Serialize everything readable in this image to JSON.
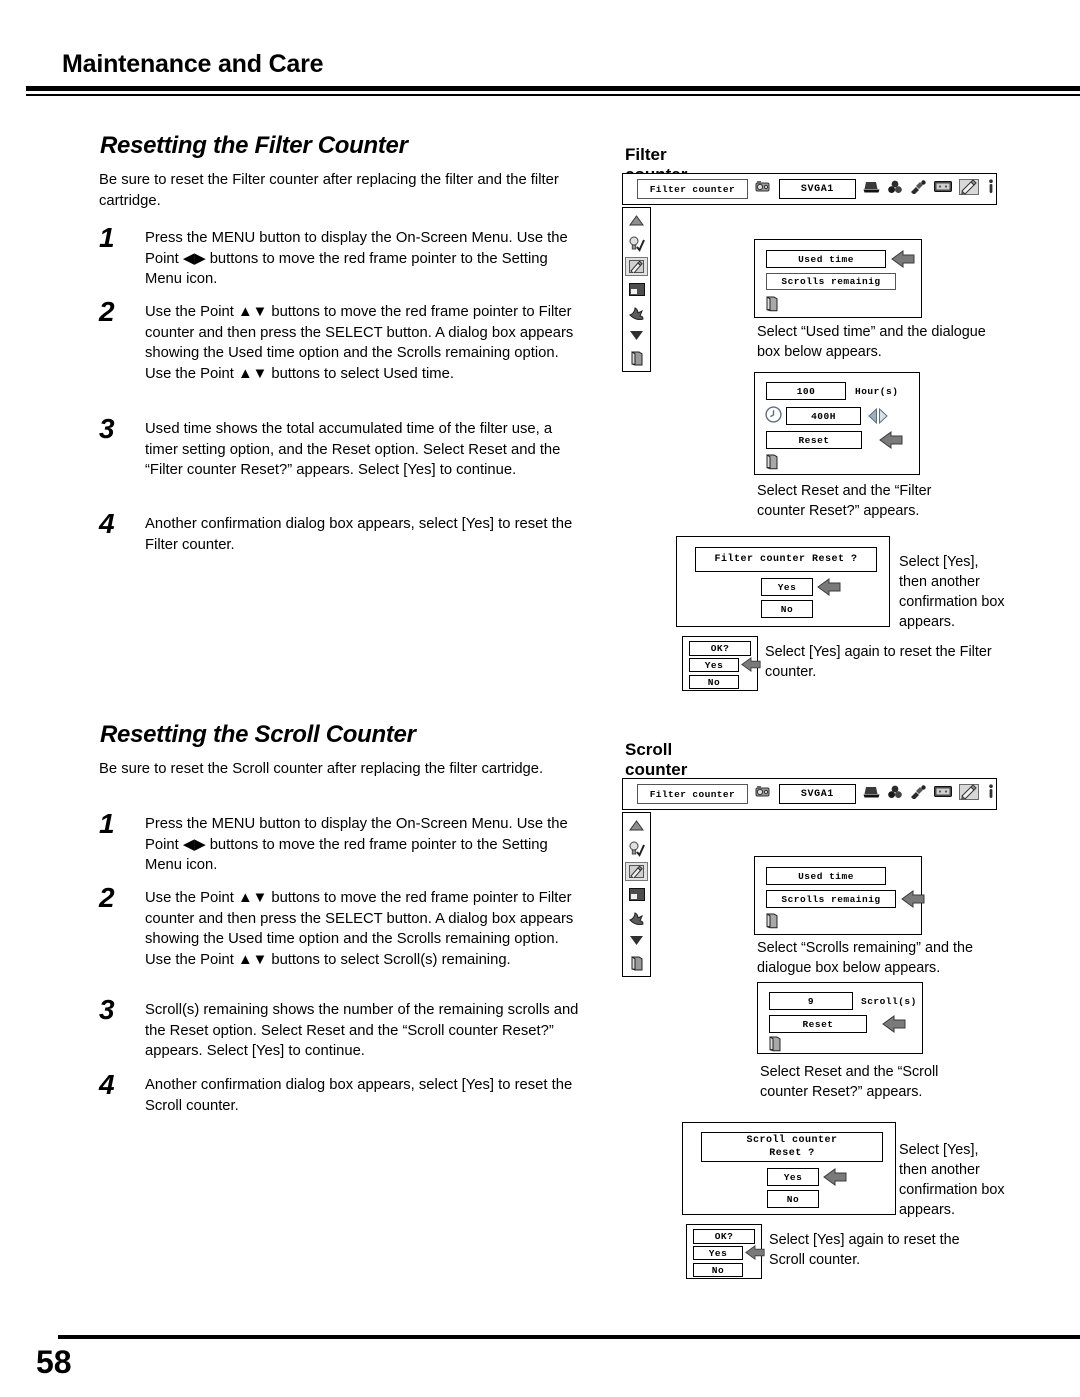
{
  "header": {
    "title": "Maintenance and Care"
  },
  "footer": {
    "page_number": "58"
  },
  "sections": {
    "filter": {
      "title": "Resetting the Filter Counter",
      "lead": "Be sure to reset the Filter counter after replacing the filter and the filter cartridge.",
      "steps": [
        {
          "num": "1",
          "text": "Press the MENU button to display the On-Screen Menu. Use the Point ◀▶ buttons to move the red frame pointer to the Setting Menu icon."
        },
        {
          "num": "2",
          "text": "Use the Point ▲▼ buttons to move the red frame pointer to Filter counter and then press the SELECT button. A dialog box appears showing the Used time option and the Scrolls remaining option. Use the Point ▲▼ buttons to select  Used time."
        },
        {
          "num": "3",
          "text": "Used time shows the total accumulated time of the filter use, a timer setting option, and the Reset option. Select Reset and the “Filter counter Reset?” appears. Select [Yes] to continue."
        },
        {
          "num": "4",
          "text": "Another confirmation dialog box appears, select [Yes] to reset the Filter counter."
        }
      ]
    },
    "scroll": {
      "title": "Resetting the Scroll Counter",
      "lead": "Be sure to reset the Scroll counter after replacing the filter cartridge.",
      "steps": [
        {
          "num": "1",
          "text": "Press the MENU button to display the On-Screen Menu. Use the Point ◀▶ buttons to move the red frame pointer to the Setting Menu icon."
        },
        {
          "num": "2",
          "text": "Use the Point ▲▼ buttons to move the red frame pointer to Filter counter and then press the SELECT button. A dialog box appears showing the Used time option and the Scrolls remaining option. Use the Point ▲▼ buttons to select Scroll(s) remaining."
        },
        {
          "num": "3",
          "text": "Scroll(s) remaining shows the number of the remaining scrolls and the Reset option. Select Reset and the “Scroll counter Reset?” appears. Select [Yes] to continue."
        },
        {
          "num": "4",
          "text": "Another confirmation dialog box appears, select [Yes] to reset the Scroll counter."
        }
      ]
    }
  },
  "figures": {
    "filter": {
      "title": "Filter counter",
      "menubar": {
        "menu_label": "Filter counter",
        "source": "SVGA1"
      },
      "dialog1": {
        "item1": "Used time",
        "item2": "Scrolls remainig"
      },
      "caption1": "Select “Used time” and the dialogue box below appears.",
      "dialog2": {
        "value": "100",
        "unit": "Hour(s)",
        "timer": "400H",
        "reset": "Reset"
      },
      "caption2": "Select Reset and the “Filter counter Reset?” appears.",
      "dialog3": {
        "question": "Filter counter Reset  ?",
        "yes": "Yes",
        "no": "No"
      },
      "caption3": "Select [Yes], then another confirmation box appears.",
      "dialog4": {
        "question": "OK?",
        "yes": "Yes",
        "no": "No"
      },
      "caption4": "Select [Yes] again to reset the Filter counter."
    },
    "scroll": {
      "title": "Scroll counter",
      "menubar": {
        "menu_label": "Filter counter",
        "source": "SVGA1"
      },
      "dialog1": {
        "item1": "Used time",
        "item2": "Scrolls remainig"
      },
      "caption1": "Select “Scrolls remaining” and the dialogue box below appears.",
      "dialog2": {
        "value": "9",
        "unit": "Scroll(s)",
        "reset": "Reset"
      },
      "caption2": "Select Reset and the “Scroll counter Reset?” appears.",
      "dialog3": {
        "question_line1": "Scroll  counter",
        "question_line2": "Reset  ?",
        "yes": "Yes",
        "no": "No"
      },
      "caption3": "Select [Yes], then another confirmation box appears.",
      "dialog4": {
        "question": "OK?",
        "yes": "Yes",
        "no": "No"
      },
      "caption4": "Select [Yes] again to reset the Scroll counter."
    }
  },
  "icons": {
    "menubar": [
      "projector-icon",
      "computer-icon",
      "color-adjust-icon",
      "image-adjust-icon",
      "screen-icon",
      "setting-icon",
      "information-icon"
    ],
    "rail": [
      "scroll-up-arrow-icon",
      "lamp-control-icon",
      "filter-counter-icon",
      "screen-aspect-icon",
      "fan-control-icon",
      "scroll-down-arrow-icon",
      "quit-exit-icon"
    ]
  }
}
